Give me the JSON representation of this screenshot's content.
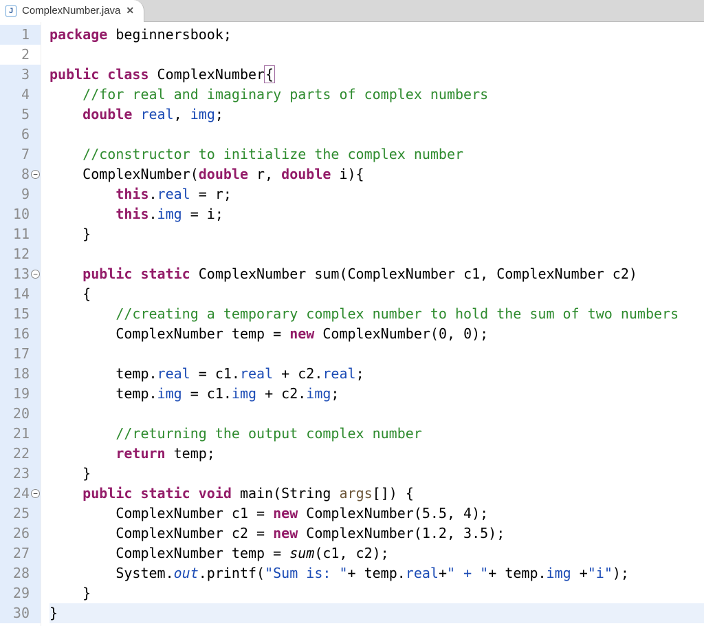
{
  "tab": {
    "filename": "ComplexNumber.java",
    "icon_letter": "J",
    "close_glyph": "✕"
  },
  "fold_lines": [
    8,
    13,
    24
  ],
  "highlighted_gutter_lines": [
    1,
    3,
    4,
    5,
    6,
    7,
    8,
    9,
    10,
    11,
    12,
    13,
    14,
    15,
    16,
    17,
    18,
    19,
    20,
    21,
    22,
    23,
    24,
    25,
    26,
    27,
    28,
    29,
    30
  ],
  "highlighted_code_lines": [
    30
  ],
  "code": [
    {
      "n": 1,
      "t": [
        [
          "kw",
          "package"
        ],
        [
          "",
          " beginnersbook;"
        ]
      ]
    },
    {
      "n": 2,
      "t": [
        [
          "",
          ""
        ]
      ]
    },
    {
      "n": 3,
      "t": [
        [
          "kw",
          "public"
        ],
        [
          "",
          " "
        ],
        [
          "kw",
          "class"
        ],
        [
          "",
          " ComplexNumber"
        ],
        [
          "cursor-box",
          "{"
        ]
      ]
    },
    {
      "n": 4,
      "t": [
        [
          "",
          "    "
        ],
        [
          "comment",
          "//for real and imaginary parts of complex numbers"
        ]
      ]
    },
    {
      "n": 5,
      "t": [
        [
          "",
          "    "
        ],
        [
          "kw",
          "double"
        ],
        [
          "",
          " "
        ],
        [
          "field",
          "real"
        ],
        [
          "",
          ", "
        ],
        [
          "field",
          "img"
        ],
        [
          "",
          ";"
        ]
      ]
    },
    {
      "n": 6,
      "t": [
        [
          "",
          ""
        ]
      ]
    },
    {
      "n": 7,
      "t": [
        [
          "",
          "    "
        ],
        [
          "comment",
          "//constructor to initialize the complex number"
        ]
      ]
    },
    {
      "n": 8,
      "t": [
        [
          "",
          "    ComplexNumber("
        ],
        [
          "kw",
          "double"
        ],
        [
          "",
          " r, "
        ],
        [
          "kw",
          "double"
        ],
        [
          "",
          " i){"
        ]
      ]
    },
    {
      "n": 9,
      "t": [
        [
          "",
          "        "
        ],
        [
          "kw",
          "this"
        ],
        [
          "",
          "."
        ],
        [
          "field",
          "real"
        ],
        [
          "",
          " = r;"
        ]
      ]
    },
    {
      "n": 10,
      "t": [
        [
          "",
          "        "
        ],
        [
          "kw",
          "this"
        ],
        [
          "",
          "."
        ],
        [
          "field",
          "img"
        ],
        [
          "",
          " = i;"
        ]
      ]
    },
    {
      "n": 11,
      "t": [
        [
          "",
          "    }"
        ]
      ]
    },
    {
      "n": 12,
      "t": [
        [
          "",
          ""
        ]
      ]
    },
    {
      "n": 13,
      "t": [
        [
          "",
          "    "
        ],
        [
          "kw",
          "public"
        ],
        [
          "",
          " "
        ],
        [
          "kw",
          "static"
        ],
        [
          "",
          " ComplexNumber sum(ComplexNumber c1, ComplexNumber c2)"
        ]
      ]
    },
    {
      "n": 14,
      "t": [
        [
          "",
          "    {"
        ]
      ]
    },
    {
      "n": 15,
      "t": [
        [
          "",
          "        "
        ],
        [
          "comment",
          "//creating a temporary complex number to hold the sum of two numbers"
        ]
      ]
    },
    {
      "n": 16,
      "t": [
        [
          "",
          "        ComplexNumber temp = "
        ],
        [
          "kw",
          "new"
        ],
        [
          "",
          " ComplexNumber(0, 0);"
        ]
      ]
    },
    {
      "n": 17,
      "t": [
        [
          "",
          ""
        ]
      ]
    },
    {
      "n": 18,
      "t": [
        [
          "",
          "        temp."
        ],
        [
          "field",
          "real"
        ],
        [
          "",
          " = c1."
        ],
        [
          "field",
          "real"
        ],
        [
          "",
          " + c2."
        ],
        [
          "field",
          "real"
        ],
        [
          "",
          ";"
        ]
      ]
    },
    {
      "n": 19,
      "t": [
        [
          "",
          "        temp."
        ],
        [
          "field",
          "img"
        ],
        [
          "",
          " = c1."
        ],
        [
          "field",
          "img"
        ],
        [
          "",
          " + c2."
        ],
        [
          "field",
          "img"
        ],
        [
          "",
          ";"
        ]
      ]
    },
    {
      "n": 20,
      "t": [
        [
          "",
          ""
        ]
      ]
    },
    {
      "n": 21,
      "t": [
        [
          "",
          "        "
        ],
        [
          "comment",
          "//returning the output complex number"
        ]
      ]
    },
    {
      "n": 22,
      "t": [
        [
          "",
          "        "
        ],
        [
          "kw",
          "return"
        ],
        [
          "",
          " temp;"
        ]
      ]
    },
    {
      "n": 23,
      "t": [
        [
          "",
          "    }"
        ]
      ]
    },
    {
      "n": 24,
      "t": [
        [
          "",
          "    "
        ],
        [
          "kw",
          "public"
        ],
        [
          "",
          " "
        ],
        [
          "kw",
          "static"
        ],
        [
          "",
          " "
        ],
        [
          "kw",
          "void"
        ],
        [
          "",
          " main(String "
        ],
        [
          "param",
          "args"
        ],
        [
          "",
          "[]) {"
        ]
      ]
    },
    {
      "n": 25,
      "t": [
        [
          "",
          "        ComplexNumber c1 = "
        ],
        [
          "kw",
          "new"
        ],
        [
          "",
          " ComplexNumber(5.5, 4);"
        ]
      ]
    },
    {
      "n": 26,
      "t": [
        [
          "",
          "        ComplexNumber c2 = "
        ],
        [
          "kw",
          "new"
        ],
        [
          "",
          " ComplexNumber(1.2, 3.5);"
        ]
      ]
    },
    {
      "n": 27,
      "t": [
        [
          "",
          "        ComplexNumber temp = "
        ],
        [
          "call-italic",
          "sum"
        ],
        [
          "",
          "(c1, c2);"
        ]
      ]
    },
    {
      "n": 28,
      "t": [
        [
          "",
          "        System."
        ],
        [
          "staticf",
          "out"
        ],
        [
          "",
          ".printf("
        ],
        [
          "str",
          "\"Sum is: \""
        ],
        [
          "",
          "+ temp."
        ],
        [
          "field",
          "real"
        ],
        [
          "",
          "+"
        ],
        [
          "str",
          "\" + \""
        ],
        [
          "",
          "+ temp."
        ],
        [
          "field",
          "img"
        ],
        [
          "",
          " +"
        ],
        [
          "str",
          "\"i\""
        ],
        [
          "",
          ");"
        ]
      ]
    },
    {
      "n": 29,
      "t": [
        [
          "",
          "    }"
        ]
      ]
    },
    {
      "n": 30,
      "t": [
        [
          "",
          "}"
        ]
      ]
    }
  ]
}
